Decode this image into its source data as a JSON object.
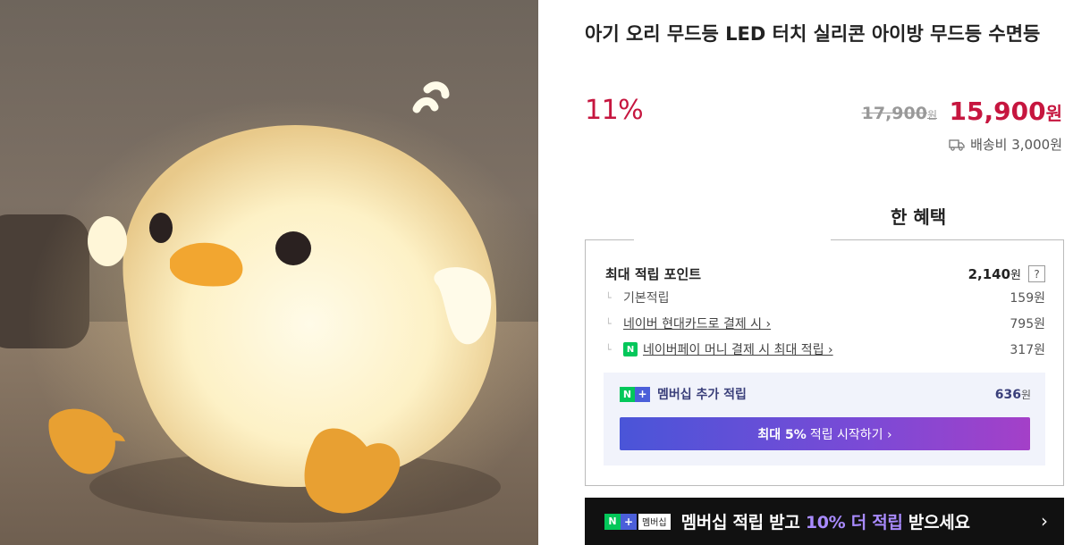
{
  "product": {
    "title": "아기 오리 무드등 LED 터치 실리콘 아이방 무드등 수면등",
    "discount_rate": "11%",
    "original_price": "17,900",
    "sale_price": "15,900",
    "currency": "원",
    "shipping_fee": "배송비 3,000원"
  },
  "benefits": {
    "heading": "한 혜택",
    "max_points_label": "최대 적립 포인트",
    "max_points_value": "2,140",
    "help_label": "?",
    "items": [
      {
        "label": "기본적립",
        "value": "159원"
      },
      {
        "label": "네이버 현대카드로 결제 시 ›",
        "value": "795원"
      },
      {
        "label": "네이버페이 머니 결제 시 최대 적립 ›",
        "value": "317원"
      }
    ],
    "membership_label": "멤버십 추가 적립",
    "membership_value": "636",
    "start_button_bold": "최대 5%",
    "start_button_text": "적립 시작하기 ›"
  },
  "banner": {
    "tag": "멤버십",
    "text_before": "멤버십 적립 받고",
    "highlight": "10% 더 적립",
    "text_after": "받으세요",
    "chevron": "›"
  },
  "colors": {
    "price_red": "#c6163f",
    "naver_green": "#03c75a",
    "membership_blue": "#4b5fd9"
  }
}
